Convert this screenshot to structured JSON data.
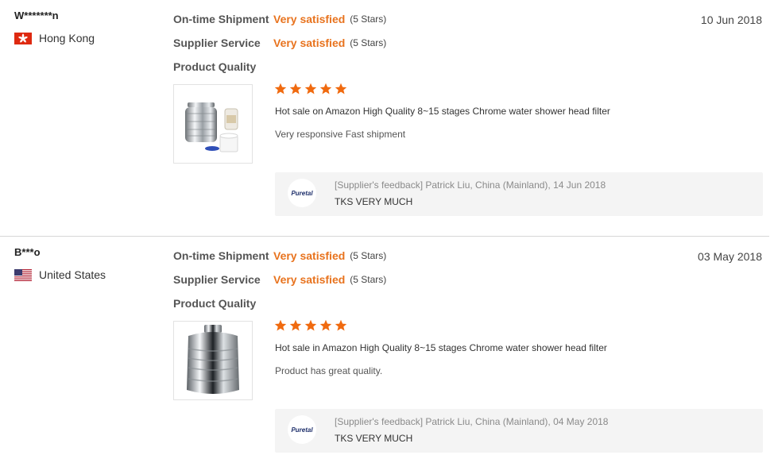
{
  "reviews": [
    {
      "buyer": "W*******n",
      "country": "Hong Kong",
      "flag_icon": "hong-kong-flag-icon",
      "date": "10 Jun 2018",
      "ratings": [
        {
          "label": "On-time Shipment",
          "value": "Very satisfied",
          "stars": "(5 Stars)"
        },
        {
          "label": "Supplier Service",
          "value": "Very satisfied",
          "stars": "(5 Stars)"
        },
        {
          "label": "Product Quality",
          "value": "",
          "stars": ""
        }
      ],
      "product_stars": 5,
      "product_name": "Hot sale on Amazon High Quality 8~15 stages Chrome water shower head filter",
      "comment": "Very responsive Fast shipment",
      "feedback": {
        "logo": "Puretal",
        "meta": "[Supplier's feedback] Patrick Liu, China (Mainland), 14 Jun 2018",
        "text": "TKS VERY MUCH"
      }
    },
    {
      "buyer": "B***o",
      "country": "United States",
      "flag_icon": "united-states-flag-icon",
      "date": "03 May 2018",
      "ratings": [
        {
          "label": "On-time Shipment",
          "value": "Very satisfied",
          "stars": "(5 Stars)"
        },
        {
          "label": "Supplier Service",
          "value": "Very satisfied",
          "stars": "(5 Stars)"
        },
        {
          "label": "Product Quality",
          "value": "",
          "stars": ""
        }
      ],
      "product_stars": 5,
      "product_name": "Hot sale in Amazon High Quality 8~15 stages Chrome water shower head filter",
      "comment": "Product has great quality.",
      "feedback": {
        "logo": "Puretal",
        "meta": "[Supplier's feedback] Patrick Liu, China (Mainland), 04 May 2018",
        "text": "TKS VERY MUCH"
      }
    }
  ],
  "colors": {
    "accent": "#e8731e",
    "star": "#f06a0f",
    "feedback_bg": "#f4f4f4"
  }
}
